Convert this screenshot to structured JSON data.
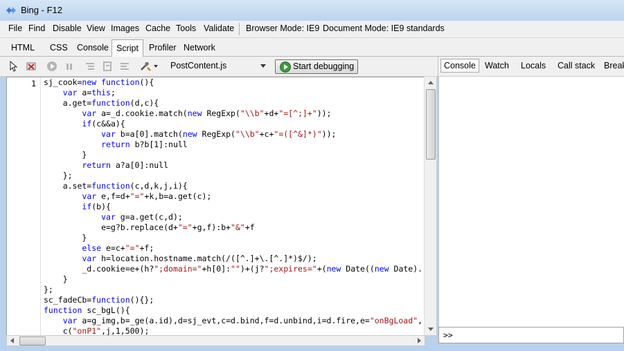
{
  "window": {
    "title": "Bing - F12"
  },
  "menu": {
    "items": [
      "File",
      "Find",
      "Disable",
      "View",
      "Images",
      "Cache",
      "Tools",
      "Validate"
    ],
    "browser_mode_label": "Browser Mode: IE9",
    "document_mode_label": "Document Mode: IE9 standards"
  },
  "tabs": [
    "HTML",
    "CSS",
    "Console",
    "Script",
    "Profiler",
    "Network"
  ],
  "active_tab": "Script",
  "toolbar": {
    "file": "PostContent.js",
    "start_debugging": "Start debugging"
  },
  "right_tabs": [
    "Console",
    "Watch",
    "Locals",
    "Call stack",
    "Breakp"
  ],
  "right_active": "Console",
  "editor": {
    "line_number": "1",
    "lines": [
      "sj_cook=new function(){",
      "    var a=this;",
      "    a.get=function(d,c){",
      "        var a=_d.cookie.match(new RegExp(\"\\\\b\"+d+\"=[^;]+\"));",
      "        if(c&&a){",
      "            var b=a[0].match(new RegExp(\"\\\\b\"+c+\"=([^&]*)\"));",
      "            return b?b[1]:null",
      "        }",
      "        return a?a[0]:null",
      "    };",
      "    a.set=function(c,d,k,j,i){",
      "        var e,f=d+\"=\"+k,b=a.get(c);",
      "        if(b){",
      "            var g=a.get(c,d);",
      "            e=g?b.replace(d+\"=\"+g,f):b+\"&\"+f",
      "        }",
      "        else e=c+\"=\"+f;",
      "        var h=location.hostname.match(/([^.]+\\.[^.]*)$/);",
      "        _d.cookie=e+(h?\";domain=\"+h[0]:\"\")+(j?\";expires=\"+(new Date((new Date).",
      "    }",
      "};",
      "sc_fadeCb=function(){};",
      "function sc_bgL(){",
      "    var a=g_img,b=_ge(a.id),d=sj_evt,c=d.bind,f=d.unbind,i=d.fire,e=\"onBgLoad\",",
      "    c(\"onP1\",j,1,500);"
    ]
  },
  "console": {
    "prompt": ">>"
  },
  "colors": {
    "keyword": "#0000ff",
    "string": "#a31515",
    "chrome": "#f0f0f0",
    "frame": "#b9d1ea"
  }
}
